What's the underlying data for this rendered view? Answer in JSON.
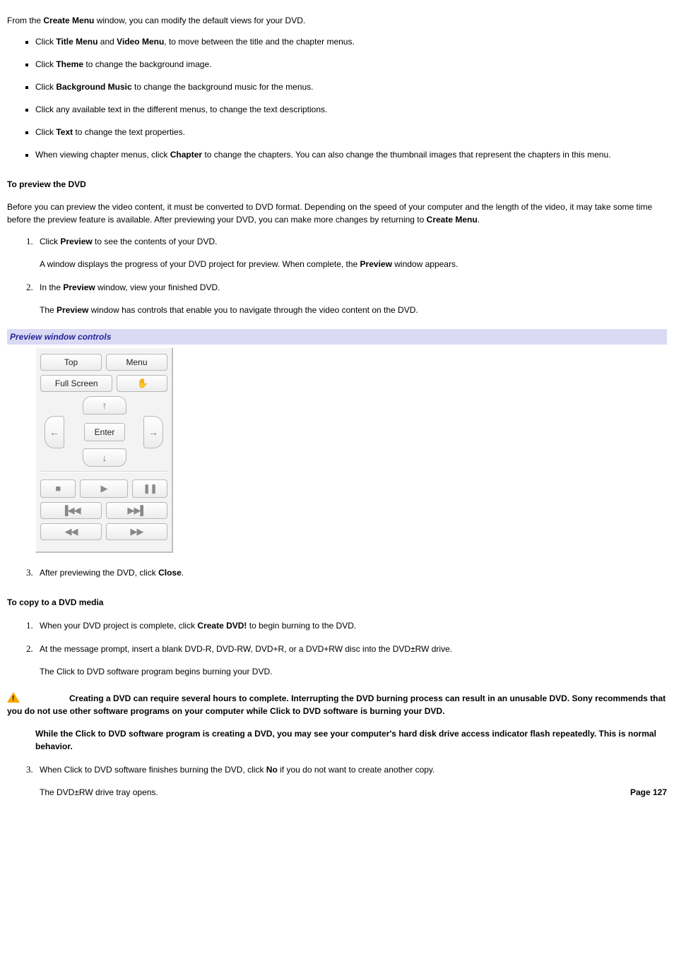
{
  "intro": {
    "pre": "From the ",
    "b1": "Create Menu",
    "post": " window, you can modify the default views for your DVD."
  },
  "bullets": {
    "b1": {
      "pre": "Click ",
      "s1": "Title Menu",
      "mid": " and ",
      "s2": "Video Menu",
      "post": ", to move between the title and the chapter menus."
    },
    "b2": {
      "pre": "Click ",
      "s1": "Theme",
      "post": " to change the background image."
    },
    "b3": {
      "pre": "Click ",
      "s1": "Background Music",
      "post": " to change the background music for the menus."
    },
    "b4": {
      "text": "Click any available text in the different menus, to change the text descriptions."
    },
    "b5": {
      "pre": "Click ",
      "s1": "Text",
      "post": " to change the text properties."
    },
    "b6": {
      "pre": "When viewing chapter menus, click ",
      "s1": "Chapter",
      "post": " to change the chapters. You can also change the thumbnail images that represent the chapters in this menu."
    }
  },
  "preview": {
    "heading": "To preview the DVD",
    "para_pre": "Before you can preview the video content, it must be converted to DVD format. Depending on the speed of your computer and the length of the video, it may take some time before the preview feature is available. After previewing your DVD, you can make more changes by returning to ",
    "para_b": "Create Menu",
    "para_post": ".",
    "steps": {
      "s1": {
        "pre": "Click ",
        "b": "Preview",
        "post": " to see the contents of your DVD."
      },
      "s1x": {
        "pre": "A window displays the progress of your DVD project for preview. When complete, the ",
        "b": "Preview",
        "post": " window appears."
      },
      "s2": {
        "pre": "In the ",
        "b": "Preview",
        "post": " window, view your finished DVD."
      },
      "s2x": {
        "pre": "The ",
        "b": "Preview",
        "post": " window has controls that enable you to navigate through the video content on the DVD."
      },
      "s3": {
        "pre": "After previewing the DVD, click ",
        "b": "Close",
        "post": "."
      }
    }
  },
  "caption": "Preview window controls",
  "controls": {
    "top": "Top",
    "menu": "Menu",
    "fullscreen": "Full Screen",
    "hand": "✋",
    "up": "↑",
    "down": "↓",
    "left": "←",
    "right": "→",
    "enter": "Enter",
    "stop": "■",
    "play": "▶",
    "pause": "❚❚",
    "skip_back": "▐◀◀",
    "skip_fwd": "▶▶▌",
    "rew": "◀◀",
    "ff": "▶▶"
  },
  "copy": {
    "heading": "To copy to a DVD media",
    "s1": {
      "pre": "When your DVD project is complete, click ",
      "b": "Create DVD!",
      "post": " to begin burning to the DVD."
    },
    "s2": {
      "text": "At the message prompt, insert a blank DVD-R, DVD-RW, DVD+R, or a DVD+RW disc into the DVD±RW drive."
    },
    "s2x": {
      "text": "The Click to DVD    software program begins burning your DVD."
    },
    "s3": {
      "pre": "When Click to DVD software finishes burning the DVD, click ",
      "b": "No",
      "post": " if you do not want to create another copy."
    },
    "s3x": {
      "text": "The DVD±RW drive tray opens."
    }
  },
  "warning": {
    "p1": "Creating a DVD can require several hours to complete. Interrupting the DVD burning process can result in an unusable DVD. Sony recommends that you do not use other software programs on your computer while Click to DVD software is burning your DVD.",
    "p2": "While the Click to DVD software program is creating a DVD, you may see your computer's hard disk drive access indicator flash repeatedly. This is normal behavior."
  },
  "page": "Page 127"
}
